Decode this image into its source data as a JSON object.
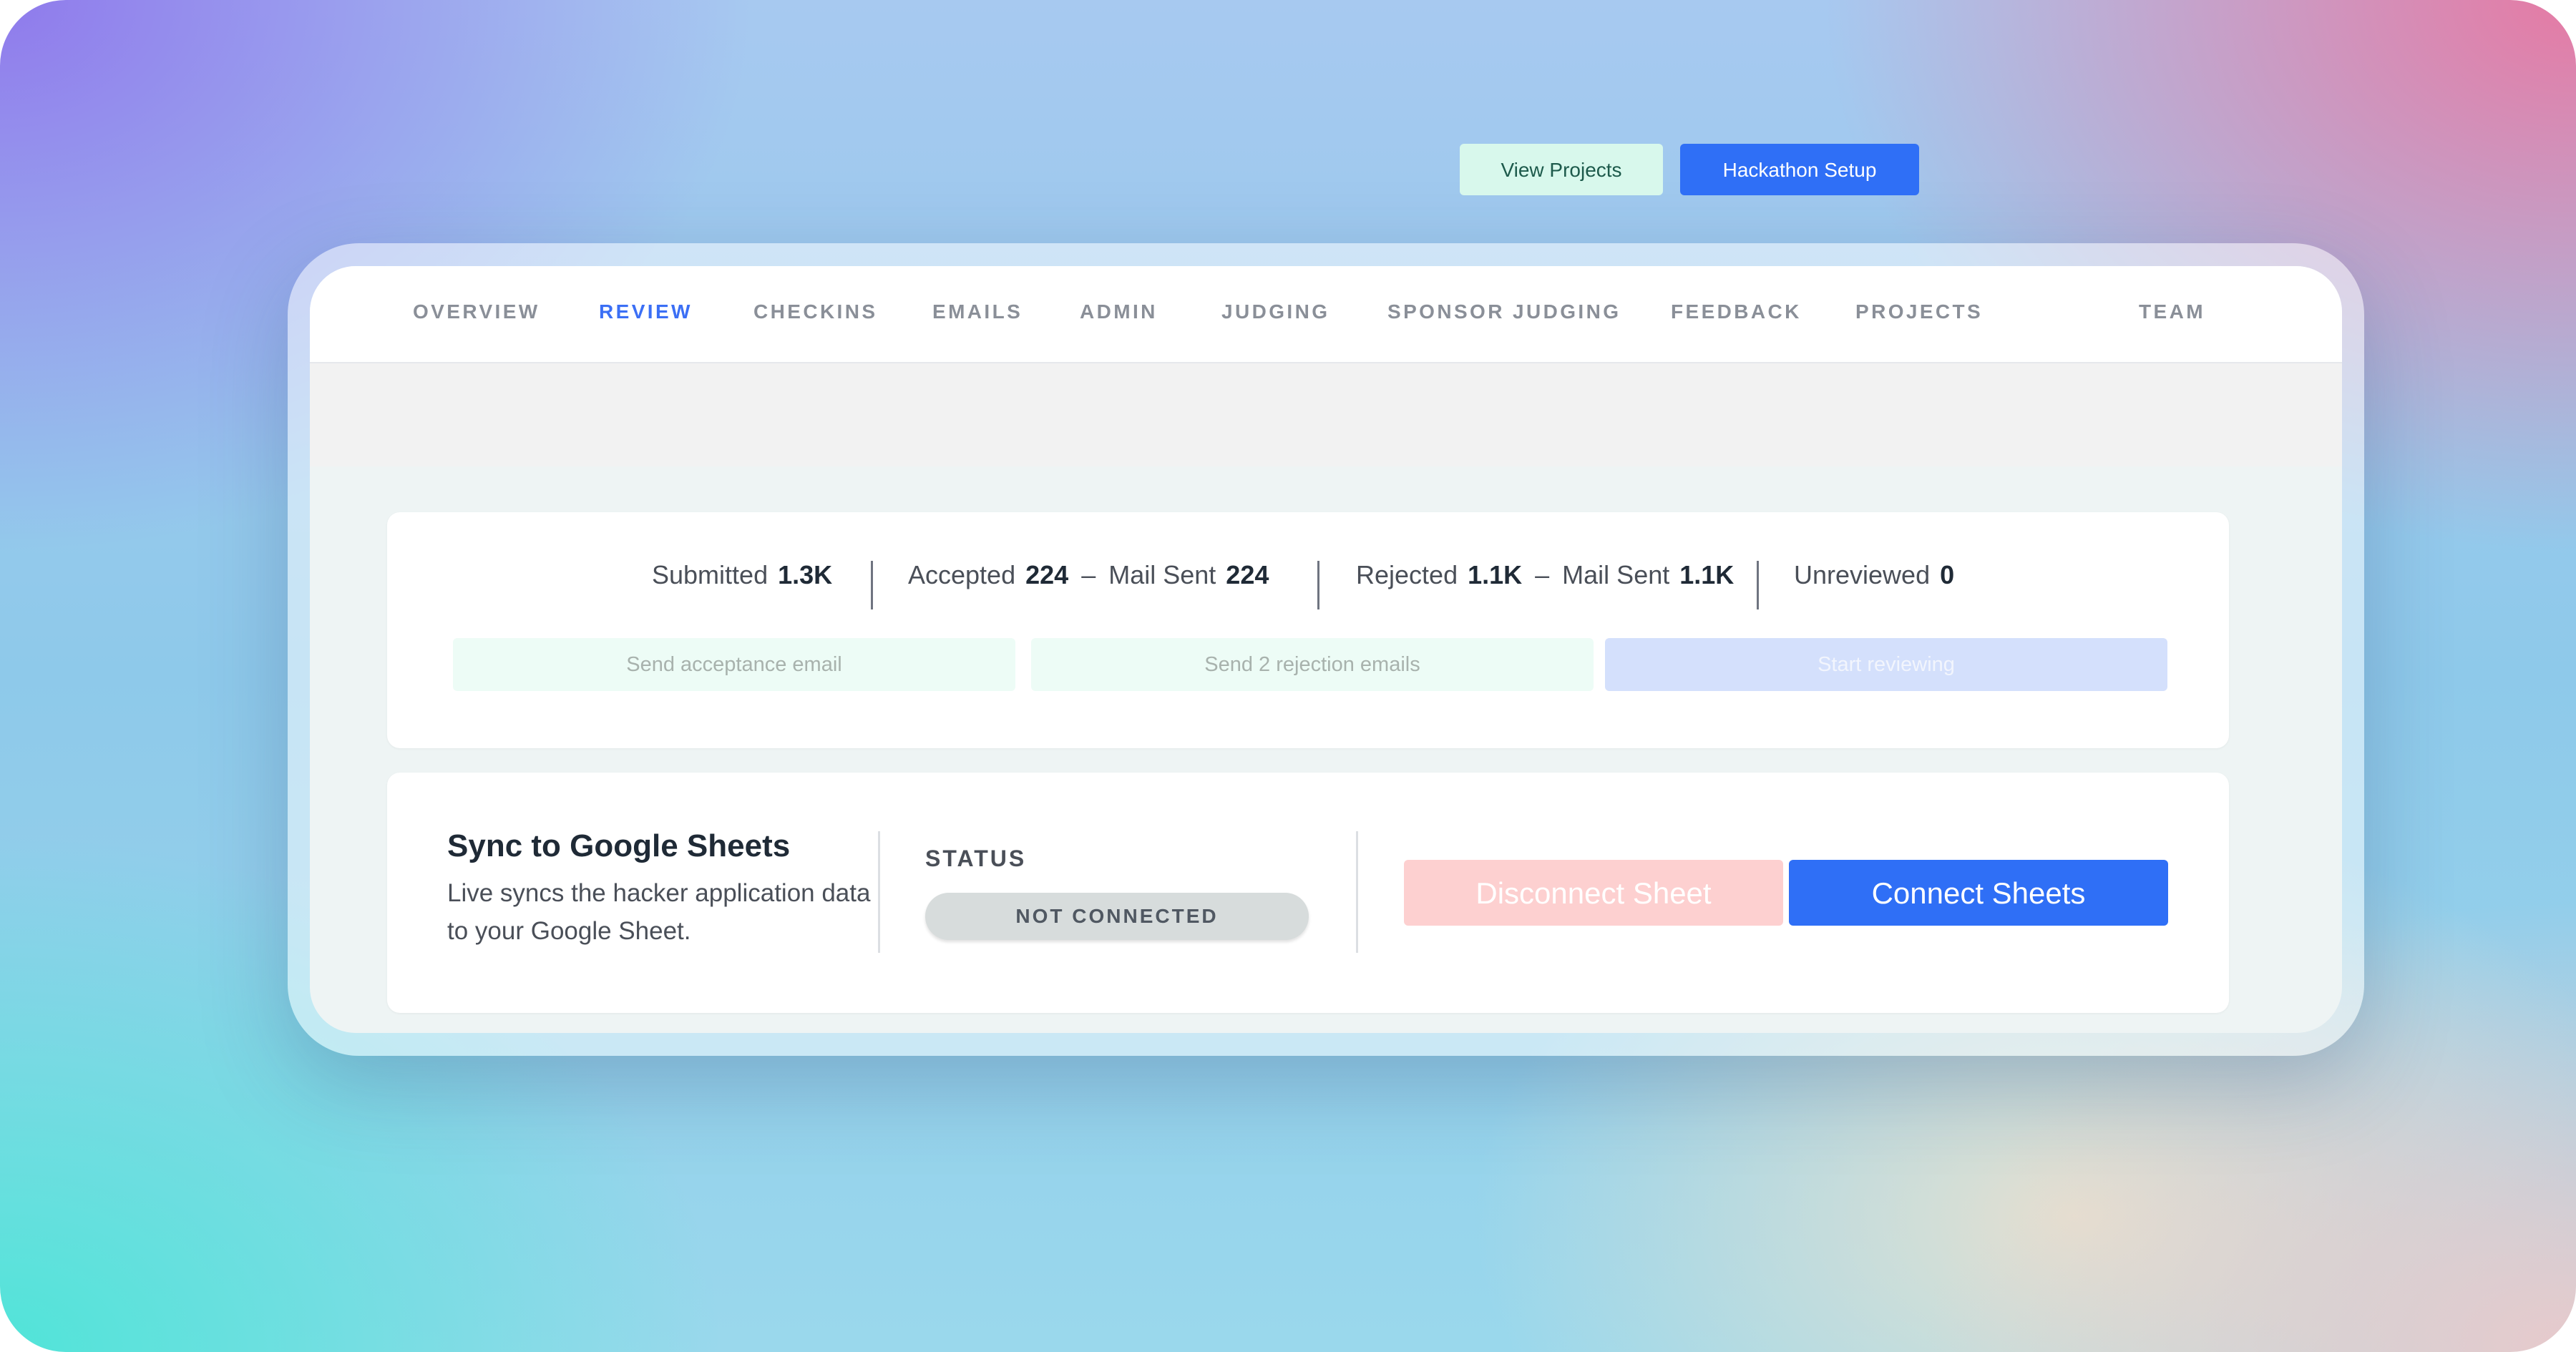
{
  "nav": {
    "items": [
      {
        "label": "OVERVIEW",
        "active": false
      },
      {
        "label": "REVIEW",
        "active": true
      },
      {
        "label": "CHECKINS",
        "active": false
      },
      {
        "label": "EMAILS",
        "active": false
      },
      {
        "label": "ADMIN",
        "active": false
      },
      {
        "label": "JUDGING",
        "active": false
      },
      {
        "label": "SPONSOR JUDGING",
        "active": false
      },
      {
        "label": "FEEDBACK",
        "active": false
      },
      {
        "label": "PROJECTS",
        "active": false
      },
      {
        "label": "TEAM",
        "active": false
      }
    ]
  },
  "actions": {
    "view_projects": "View Projects",
    "hackathon_setup": "Hackathon Setup"
  },
  "stats": {
    "submitted_label": "Submitted",
    "submitted_value": "1.3K",
    "accepted_label": "Accepted",
    "accepted_value": "224",
    "accepted_mail_label": "Mail Sent",
    "accepted_mail_value": "224",
    "rejected_label": "Rejected",
    "rejected_value": "1.1K",
    "rejected_mail_label": "Mail Sent",
    "rejected_mail_value": "1.1K",
    "unreviewed_label": "Unreviewed",
    "unreviewed_value": "0",
    "dash": "–"
  },
  "review_buttons": {
    "send_acceptance": "Send acceptance email",
    "send_rejection": "Send 2 rejection emails",
    "start_reviewing": "Start reviewing"
  },
  "sync": {
    "title": "Sync to Google Sheets",
    "description": "Live syncs the hacker application data to your Google Sheet.",
    "status_label": "STATUS",
    "status_value": "NOT CONNECTED",
    "disconnect": "Disconnect Sheet",
    "connect": "Connect Sheets"
  },
  "colors": {
    "accent": "#2f6ff6",
    "active_tab": "#3b6ff5",
    "disconnect_bg": "#fdd0d0",
    "view_projects_bg": "#d8f8ec"
  }
}
